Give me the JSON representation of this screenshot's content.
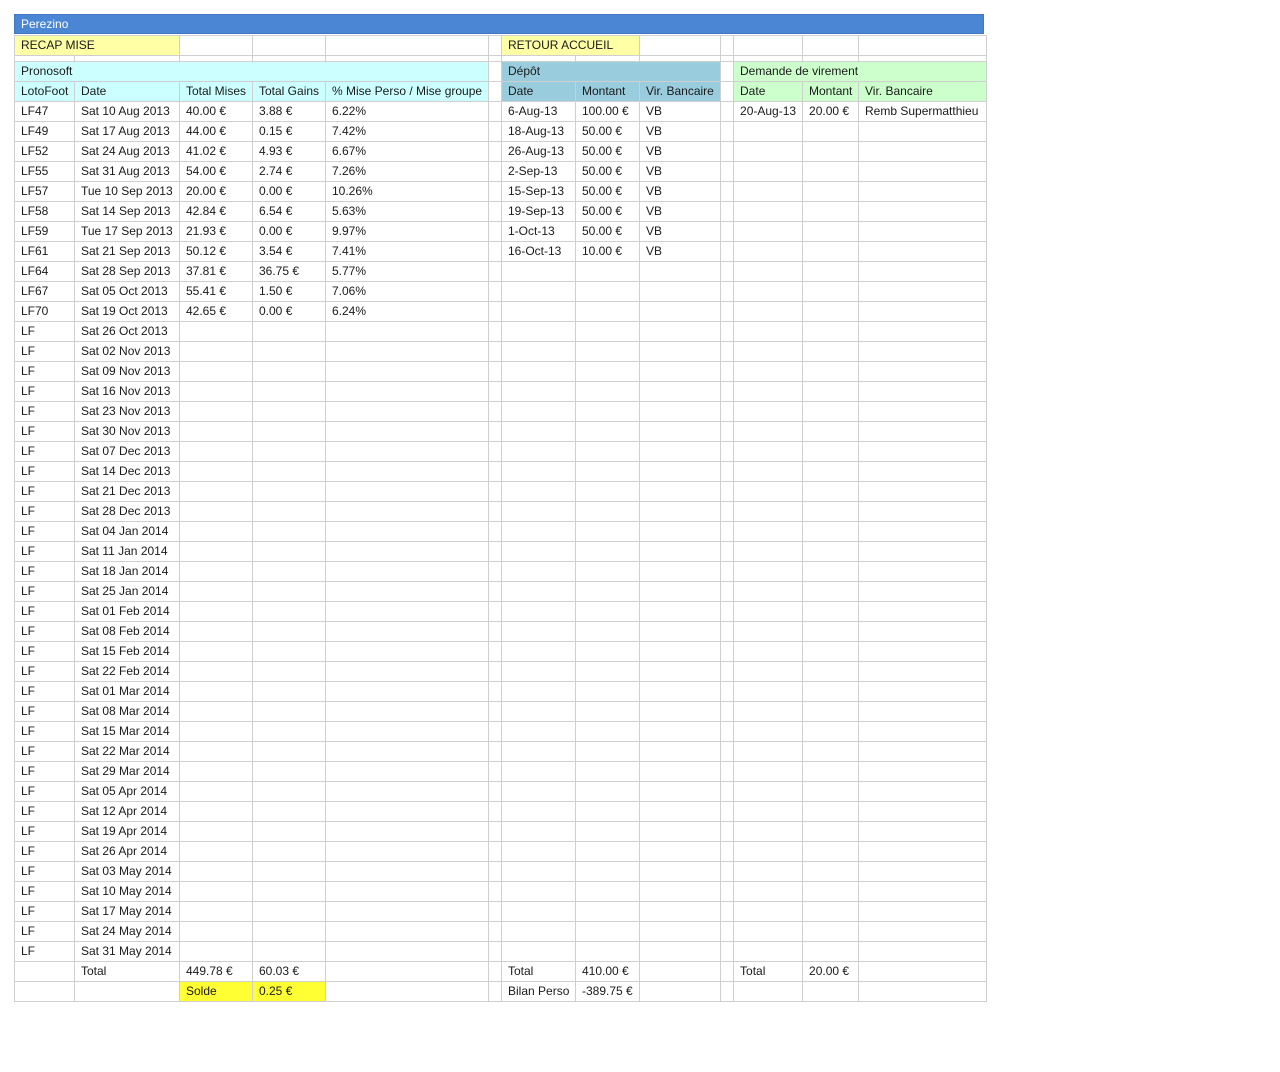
{
  "window": {
    "title": "Perezino"
  },
  "nav": {
    "recap_label": "RECAP MISE",
    "retour_label": "RETOUR ACCUEIL"
  },
  "pronosoft": {
    "title": "Pronosoft",
    "headers": [
      "LotoFoot",
      "Date",
      "Total Mises",
      "Total Gains",
      "% Mise Perso / Mise groupe"
    ],
    "rows": [
      [
        "LF47",
        "Sat 10 Aug 2013",
        "40.00 €",
        "3.88 €",
        "6.22%"
      ],
      [
        "LF49",
        "Sat 17 Aug 2013",
        "44.00 €",
        "0.15 €",
        "7.42%"
      ],
      [
        "LF52",
        "Sat 24 Aug 2013",
        "41.02 €",
        "4.93 €",
        "6.67%"
      ],
      [
        "LF55",
        "Sat 31 Aug 2013",
        "54.00 €",
        "2.74 €",
        "7.26%"
      ],
      [
        "LF57",
        "Tue 10 Sep 2013",
        "20.00 €",
        "0.00 €",
        "10.26%"
      ],
      [
        "LF58",
        "Sat 14 Sep 2013",
        "42.84 €",
        "6.54 €",
        "5.63%"
      ],
      [
        "LF59",
        "Tue 17 Sep 2013",
        "21.93 €",
        "0.00 €",
        "9.97%"
      ],
      [
        "LF61",
        "Sat 21 Sep 2013",
        "50.12 €",
        "3.54 €",
        "7.41%"
      ],
      [
        "LF64",
        "Sat 28 Sep 2013",
        "37.81 €",
        "36.75 €",
        "5.77%"
      ],
      [
        "LF67",
        "Sat 05 Oct 2013",
        "55.41 €",
        "1.50 €",
        "7.06%"
      ],
      [
        "LF70",
        "Sat 19 Oct 2013",
        "42.65 €",
        "0.00 €",
        "6.24%"
      ],
      [
        "LF",
        "Sat 26 Oct 2013",
        "",
        "",
        ""
      ],
      [
        "LF",
        "Sat 02 Nov 2013",
        "",
        "",
        ""
      ],
      [
        "LF",
        "Sat 09 Nov 2013",
        "",
        "",
        ""
      ],
      [
        "LF",
        "Sat 16 Nov 2013",
        "",
        "",
        ""
      ],
      [
        "LF",
        "Sat 23 Nov 2013",
        "",
        "",
        ""
      ],
      [
        "LF",
        "Sat 30 Nov 2013",
        "",
        "",
        ""
      ],
      [
        "LF",
        "Sat 07 Dec 2013",
        "",
        "",
        ""
      ],
      [
        "LF",
        "Sat 14 Dec 2013",
        "",
        "",
        ""
      ],
      [
        "LF",
        "Sat 21 Dec 2013",
        "",
        "",
        ""
      ],
      [
        "LF",
        "Sat 28 Dec 2013",
        "",
        "",
        ""
      ],
      [
        "LF",
        "Sat 04 Jan 2014",
        "",
        "",
        ""
      ],
      [
        "LF",
        "Sat 11 Jan 2014",
        "",
        "",
        ""
      ],
      [
        "LF",
        "Sat 18 Jan 2014",
        "",
        "",
        ""
      ],
      [
        "LF",
        "Sat 25 Jan 2014",
        "",
        "",
        ""
      ],
      [
        "LF",
        "Sat 01 Feb 2014",
        "",
        "",
        ""
      ],
      [
        "LF",
        "Sat 08 Feb 2014",
        "",
        "",
        ""
      ],
      [
        "LF",
        "Sat 15 Feb 2014",
        "",
        "",
        ""
      ],
      [
        "LF",
        "Sat 22 Feb 2014",
        "",
        "",
        ""
      ],
      [
        "LF",
        "Sat 01 Mar 2014",
        "",
        "",
        ""
      ],
      [
        "LF",
        "Sat 08 Mar 2014",
        "",
        "",
        ""
      ],
      [
        "LF",
        "Sat 15 Mar 2014",
        "",
        "",
        ""
      ],
      [
        "LF",
        "Sat 22 Mar 2014",
        "",
        "",
        ""
      ],
      [
        "LF",
        "Sat 29 Mar 2014",
        "",
        "",
        ""
      ],
      [
        "LF",
        "Sat 05 Apr 2014",
        "",
        "",
        ""
      ],
      [
        "LF",
        "Sat 12 Apr 2014",
        "",
        "",
        ""
      ],
      [
        "LF",
        "Sat 19 Apr 2014",
        "",
        "",
        ""
      ],
      [
        "LF",
        "Sat 26 Apr 2014",
        "",
        "",
        ""
      ],
      [
        "LF",
        "Sat 03 May 2014",
        "",
        "",
        ""
      ],
      [
        "LF",
        "Sat 10 May 2014",
        "",
        "",
        ""
      ],
      [
        "LF",
        "Sat 17 May 2014",
        "",
        "",
        ""
      ],
      [
        "LF",
        "Sat 24 May 2014",
        "",
        "",
        ""
      ],
      [
        "LF",
        "Sat 31 May 2014",
        "",
        "",
        ""
      ]
    ],
    "total_label": "Total",
    "total_mises": "449.78 €",
    "total_gains": "60.03 €",
    "solde_label": "Solde",
    "solde_value": "0.25 €"
  },
  "depot": {
    "title": "Dépôt",
    "headers": [
      "Date",
      "Montant",
      "Vir. Bancaire"
    ],
    "rows": [
      [
        "6-Aug-13",
        "100.00 €",
        "VB"
      ],
      [
        "18-Aug-13",
        "50.00 €",
        "VB"
      ],
      [
        "26-Aug-13",
        "50.00 €",
        "VB"
      ],
      [
        "2-Sep-13",
        "50.00 €",
        "VB"
      ],
      [
        "15-Sep-13",
        "50.00 €",
        "VB"
      ],
      [
        "19-Sep-13",
        "50.00 €",
        "VB"
      ],
      [
        "1-Oct-13",
        "50.00 €",
        "VB"
      ],
      [
        "16-Oct-13",
        "10.00 €",
        "VB"
      ]
    ],
    "total_label": "Total",
    "total_value": "410.00 €",
    "bilan_label": "Bilan Perso",
    "bilan_value": "-389.75 €"
  },
  "virement": {
    "title": "Demande de virement",
    "headers": [
      "Date",
      "Montant",
      "Vir. Bancaire"
    ],
    "rows": [
      [
        "20-Aug-13",
        "20.00 €",
        "Remb Supermatthieu"
      ]
    ],
    "total_label": "Total",
    "total_value": "20.00 €"
  },
  "colors": {
    "title_bar": "#4a86d4",
    "recap": "#ffffa6",
    "pronosoft": "#ccffff",
    "depot": "#99ccdd",
    "virement": "#ccffcc",
    "solde": "#ffff33",
    "grid_line": "#cfcfcf"
  }
}
